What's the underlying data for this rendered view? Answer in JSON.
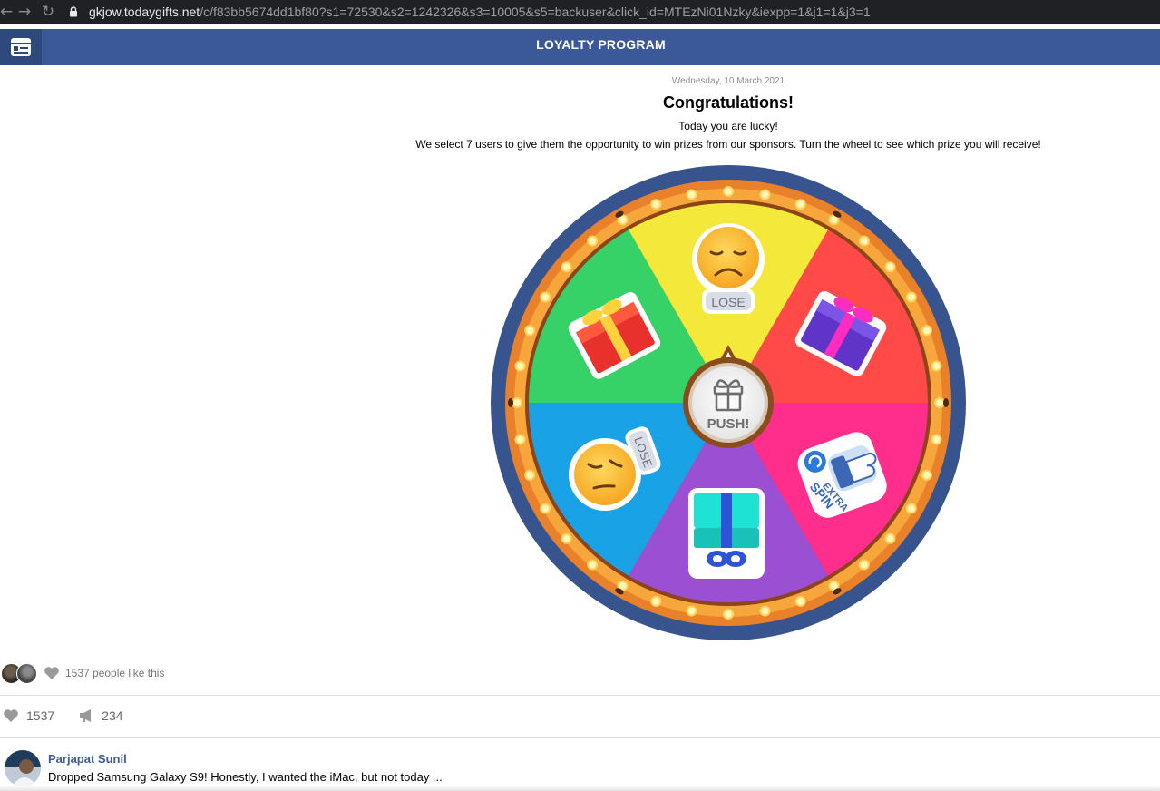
{
  "browser": {
    "url_host": "gkjow.todaygifts.net",
    "url_path": "/c/f83bb5674dd1bf80?s1=72530&s2=1242326&s3=10005&s5=backuser&click_id=MTEzNi01Nzky&iexpp=1&j1=1&j3=1"
  },
  "header": {
    "title": "LOYALTY PROGRAM"
  },
  "intro": {
    "date": "Wednesday, 10 March 2021",
    "headline": "Congratulations!",
    "subline": "Today you are lucky!",
    "description": "We select 7 users to give them the opportunity to win prizes from our sponsors. Turn the wheel to see which prize you will receive!"
  },
  "wheel": {
    "center_label": "PUSH!",
    "segments": [
      {
        "color": "#f4e83a",
        "prize": "LOSE",
        "icon": "sad-face-icon"
      },
      {
        "color": "#ff4a47",
        "prize": "",
        "icon": "purple-gift-icon"
      },
      {
        "color": "#ff2d8c",
        "prize": "EXTRA SPIN",
        "icon": "thumbs-down-icon"
      },
      {
        "color": "#9b4fd2",
        "prize": "",
        "icon": "teal-gift-icon"
      },
      {
        "color": "#1aa2e6",
        "prize": "LOSE",
        "icon": "sleepy-face-icon"
      },
      {
        "color": "#36d167",
        "prize": "",
        "icon": "red-gift-icon"
      }
    ],
    "colors": {
      "rim": "#37548f",
      "ring": "#f19a2c",
      "bulb": "#fff6b8"
    }
  },
  "social": {
    "likes_text": "1537 people like this",
    "like_count": "1537",
    "share_count": "234"
  },
  "comment": {
    "author": "Parjapat Sunil",
    "text": "Dropped Samsung Galaxy S9! Honestly, I wanted the iMac, but not today ..."
  }
}
